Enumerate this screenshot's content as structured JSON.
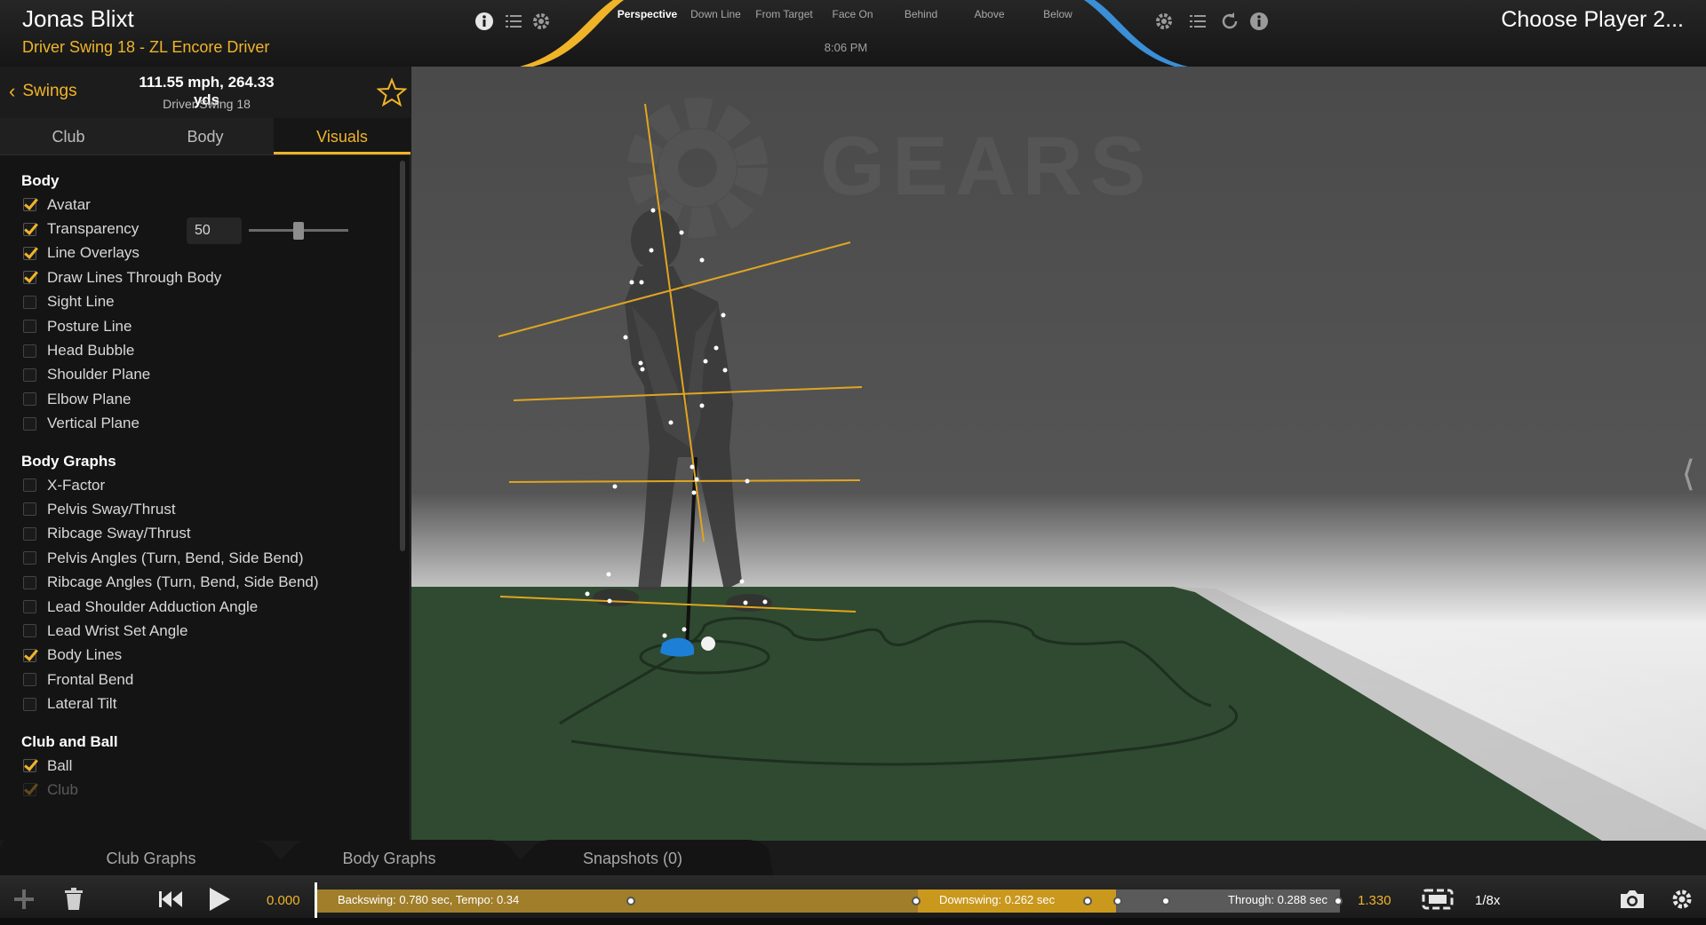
{
  "header": {
    "player_name": "Jonas Blixt",
    "swing_title": "Driver Swing 18 - ZL Encore Driver",
    "time": "8:06 PM",
    "right_title": "Choose Player 2...",
    "view_tabs": [
      "Perspective",
      "Down Line",
      "From Target",
      "Face On",
      "Behind",
      "Above",
      "Below"
    ],
    "active_view": "Perspective"
  },
  "sidebar": {
    "back_label": "Swings",
    "stats": "111.55 mph, 264.33 yds",
    "swing_name": "Driver Swing 18",
    "tabs": [
      "Club",
      "Body",
      "Visuals"
    ],
    "active_tab": "Visuals",
    "sections": {
      "body": {
        "title": "Body",
        "items": [
          {
            "label": "Avatar",
            "checked": true
          },
          {
            "label": "Transparency",
            "checked": true,
            "value": "50",
            "slider_fraction": 0.5
          },
          {
            "label": "Line Overlays",
            "checked": true
          },
          {
            "label": "Draw Lines Through Body",
            "checked": true
          },
          {
            "label": "Sight Line",
            "checked": false
          },
          {
            "label": "Posture Line",
            "checked": false
          },
          {
            "label": "Head Bubble",
            "checked": false
          },
          {
            "label": "Shoulder Plane",
            "checked": false
          },
          {
            "label": "Elbow Plane",
            "checked": false
          },
          {
            "label": "Vertical Plane",
            "checked": false
          }
        ]
      },
      "body_graphs": {
        "title": "Body Graphs",
        "items": [
          {
            "label": "X-Factor",
            "checked": false
          },
          {
            "label": "Pelvis Sway/Thrust",
            "checked": false
          },
          {
            "label": "Ribcage Sway/Thrust",
            "checked": false
          },
          {
            "label": "Pelvis Angles (Turn, Bend, Side Bend)",
            "checked": false
          },
          {
            "label": "Ribcage Angles (Turn, Bend, Side Bend)",
            "checked": false
          },
          {
            "label": "Lead Shoulder Adduction Angle",
            "checked": false
          },
          {
            "label": "Lead Wrist Set Angle",
            "checked": false
          },
          {
            "label": "Body Lines",
            "checked": true
          },
          {
            "label": "Frontal Bend",
            "checked": false
          },
          {
            "label": "Lateral Tilt",
            "checked": false
          }
        ]
      },
      "club_ball": {
        "title": "Club and Ball",
        "items": [
          {
            "label": "Ball",
            "checked": true
          },
          {
            "label": "Club",
            "checked": true
          }
        ]
      }
    }
  },
  "viewport": {
    "logo_text": "GEARS"
  },
  "bottom_tabs": [
    "Club Graphs",
    "Body Graphs",
    "Snapshots (0)"
  ],
  "playback": {
    "time_start": "0.000",
    "time_end": "1.330",
    "backswing_label": "Backswing: 0.780 sec, Tempo: 0.34",
    "downswing_label": "Downswing: 0.262 sec",
    "through_label": "Through: 0.288 sec",
    "speed": "1/8x"
  },
  "colors": {
    "accent": "#f0b429",
    "accent_blue": "#3a8fd6",
    "turf": "#2f4a30"
  }
}
